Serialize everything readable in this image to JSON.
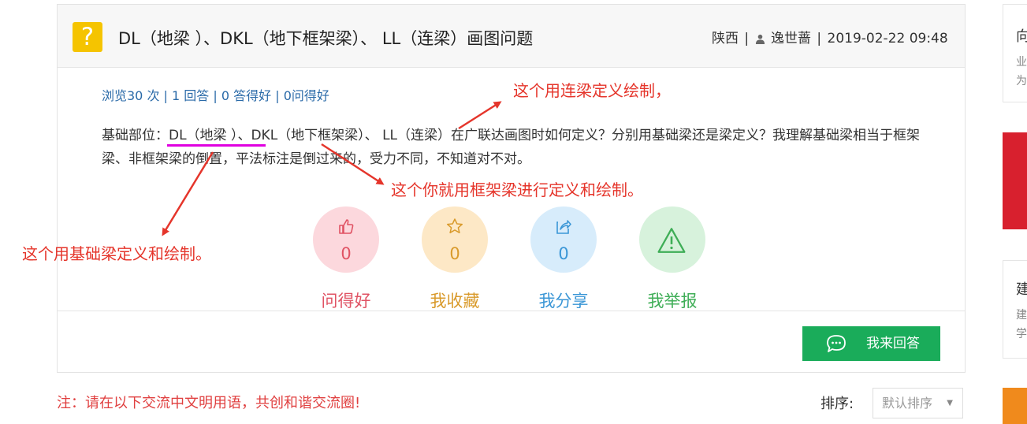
{
  "question": {
    "icon": "question-mark-icon",
    "icon_text": "?",
    "title": "DL（地梁 ）、DKL（地下框架梁）、 LL（连梁）画图问题",
    "region": "陕西",
    "user_icon": "user-icon",
    "author": "逸世蔷",
    "time": "2019-02-22 09:48:30",
    "sep": "|"
  },
  "stats": {
    "views": "浏览30 次",
    "answers": "1 回答",
    "good_answers": "0 答得好",
    "good_questions": "0问得好",
    "sep": " | "
  },
  "content": {
    "text": "基础部位：DL（地梁 ）、DKL（地下框架梁）、 LL（连梁）在广联达画图时如何定义？分别用基础梁还是梁定义？我理解基础梁相当于框架梁、非框架梁的倒置，平法标注是倒过来的，受力不同，不知道对不对。"
  },
  "actions": [
    {
      "icon": "thumbs-up-icon",
      "count": "0",
      "label": "问得好",
      "color": "#e05364"
    },
    {
      "icon": "star-icon",
      "count": "0",
      "label": "我收藏",
      "color": "#d99a2b"
    },
    {
      "icon": "share-icon",
      "count": "0",
      "label": "我分享",
      "color": "#3a96d6"
    },
    {
      "icon": "warning-icon",
      "label": "我举报",
      "color": "#3fae57"
    }
  ],
  "answer_button": {
    "icon": "chat-bubble-icon",
    "label": "我来回答"
  },
  "note": "注：请在以下交流中文明用语，共创和谐交流圈!",
  "sort": {
    "label": "排序:",
    "value": "默认排序"
  },
  "annotations": {
    "ll": "这个用连梁定义绘制，",
    "dkl": "这个你就用框架梁进行定义和绘制。",
    "dl": "这个用基础梁定义和绘制。"
  },
  "sidebar": {
    "card1": {
      "title": "向",
      "line1": "业",
      "line2": "为"
    },
    "card2": {
      "title": "建",
      "line1": "建",
      "line2": "学"
    }
  },
  "colors": {
    "accent_green": "#1aac5a",
    "annotation_red": "#e5352b",
    "link_blue": "#2a6aa8",
    "underline_magenta": "#e000e0"
  }
}
